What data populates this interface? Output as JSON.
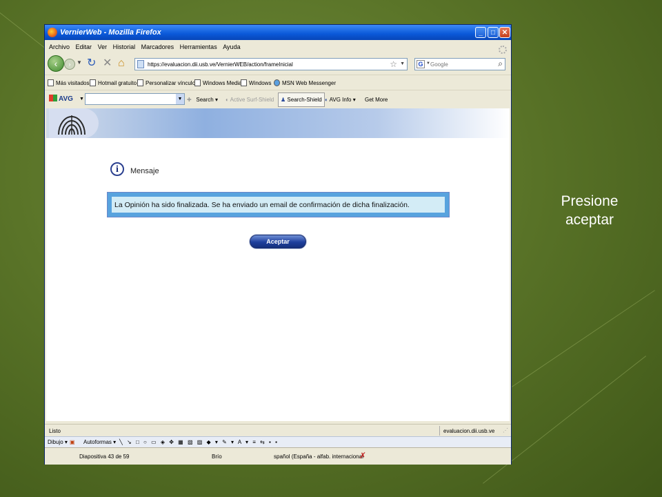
{
  "slide": {
    "caption_line1": "Presione",
    "caption_line2": "aceptar"
  },
  "window": {
    "title": "VernierWeb - Mozilla Firefox"
  },
  "menu": [
    "Archivo",
    "Editar",
    "Ver",
    "Historial",
    "Marcadores",
    "Herramientas",
    "Ayuda"
  ],
  "navbar": {
    "url": "https://evaluacion.dii.usb.ve/VernierWEB/action/frameInicial",
    "search_placeholder": "Google"
  },
  "bookmarks": [
    "Más visitados",
    "Hotmail gratuito",
    "Personalizar vínculos",
    "Windows Media",
    "Windows",
    "MSN Web Messenger"
  ],
  "avg_toolbar": {
    "logo": "AVG",
    "search": "Search",
    "active_surf": "Active Surf-Shield",
    "search_shield": "Search-Shield",
    "avg_info": "AVG Info",
    "get_more": "Get More"
  },
  "content": {
    "message_title": "Mensaje",
    "message_text": "La Opinión ha sido finalizada. Se ha enviado un email de confirmación de dicha finalización.",
    "accept_label": "Aceptar"
  },
  "statusbar": {
    "left": "Listo",
    "right": "evaluacion.dii.usb.ve"
  },
  "ppt_draw": {
    "dibujo": "Dibujo",
    "autoformas": "Autoformas"
  },
  "ppt_status": {
    "slide": "Diapositiva 43 de 59",
    "design": "Brío",
    "language": "spañol (España - alfab. internacional"
  }
}
